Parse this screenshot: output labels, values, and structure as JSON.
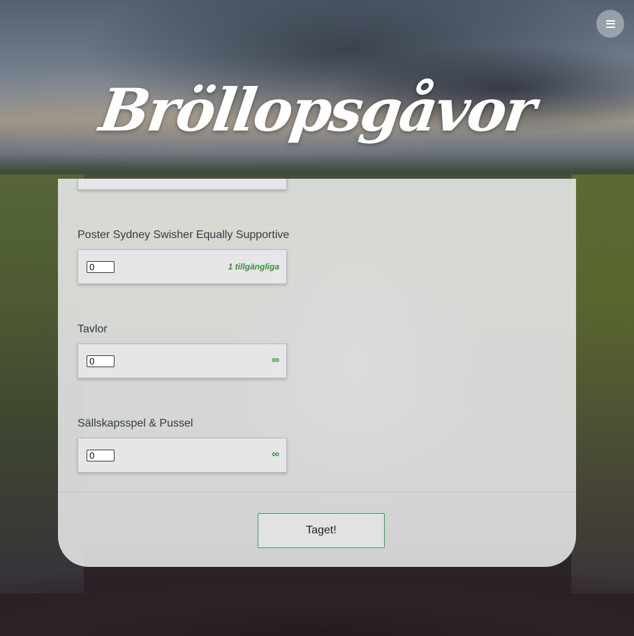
{
  "header": {
    "title": "Bröllopsgåvor",
    "menu_icon": "hamburger-menu-icon"
  },
  "gifts": [
    {
      "label": "",
      "quantity": "",
      "availability": ""
    },
    {
      "label": "Poster Sydney Swisher Equally Supportive",
      "quantity": "0",
      "availability": "1 tillgängliga"
    },
    {
      "label": "Tavlor",
      "quantity": "0",
      "availability": "∞"
    },
    {
      "label": "Sällskapsspel & Pussel",
      "quantity": "0",
      "availability": "∞"
    }
  ],
  "submit": {
    "label": "Taget!"
  },
  "colors": {
    "availability_green": "#3f8a3f",
    "button_border": "#3d9b56"
  }
}
